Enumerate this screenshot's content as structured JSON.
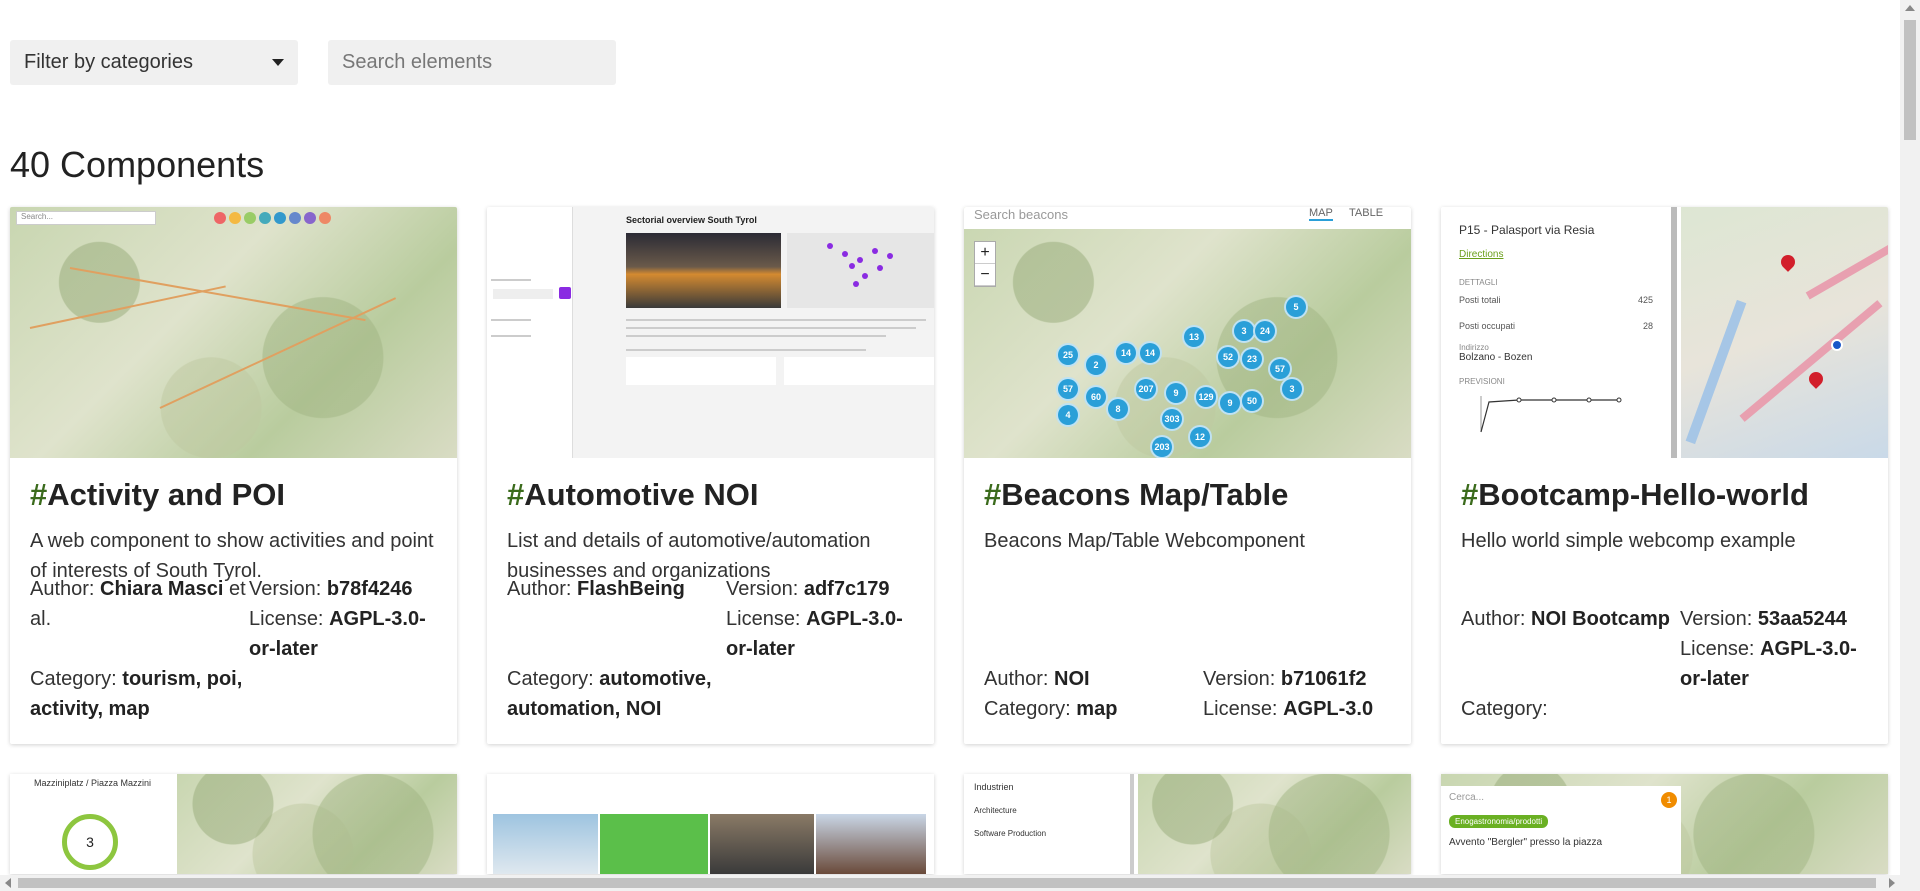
{
  "toolbar": {
    "filter_label": "Filter by categories",
    "search_placeholder": "Search elements"
  },
  "heading": "40 Components",
  "cards": [
    {
      "hash": "#",
      "title": "Activity and POI",
      "description": "A web component to show activities and point of interests of South Tyrol.",
      "author_label": "Author:",
      "author": "Chiara Masci",
      "author_suffix": "et al.",
      "category_label": "Category:",
      "category": "tourism, poi, activity, map",
      "version_label": "Version:",
      "version": "b78f4246",
      "license_label": "License:",
      "license": "AGPL-3.0-or-later",
      "thumb_text": "Search..."
    },
    {
      "hash": "#",
      "title": "Automotive NOI",
      "description": "List and details of automotive/automation businesses and organizations",
      "author_label": "Author:",
      "author": "FlashBeing",
      "category_label": "Category:",
      "category": "automotive, automation, NOI",
      "version_label": "Version:",
      "version": "adf7c179",
      "license_label": "License:",
      "license": "AGPL-3.0-or-later",
      "thumb_text": "Sectorial overview South Tyrol"
    },
    {
      "hash": "#",
      "title": "Beacons Map/Table",
      "description": "Beacons Map/Table Webcomponent",
      "author_label": "Author:",
      "author": "NOI",
      "category_label": "Category:",
      "category": "map",
      "version_label": "Version:",
      "version": "b71061f2",
      "license_label": "License:",
      "license": "AGPL-3.0",
      "thumb_text": "Search beacons",
      "tab_map": "MAP",
      "tab_table": "TABLE",
      "clusters": [
        "5",
        "3",
        "24",
        "13",
        "14",
        "52",
        "23",
        "57",
        "25",
        "2",
        "14",
        "57",
        "60",
        "8",
        "207",
        "9",
        "129",
        "9",
        "50",
        "3",
        "4",
        "303",
        "12",
        "203"
      ]
    },
    {
      "hash": "#",
      "title": "Bootcamp-Hello-world",
      "description": "Hello world simple webcomp example",
      "author_label": "Author:",
      "author": "NOI Bootcamp",
      "category_label": "Category:",
      "category": "",
      "version_label": "Version:",
      "version": "53aa5244",
      "license_label": "License:",
      "license": "AGPL-3.0-or-later",
      "panel_title": "P15 - Palasport via Resia",
      "panel_link": "Directions",
      "panel_details": "DETTAGLI",
      "panel_row1_label": "Posti totali",
      "panel_row1_value": "425",
      "panel_row2_label": "Posti occupati",
      "panel_row2_value": "28",
      "panel_addr_label": "Indirizzo",
      "panel_addr": "Bolzano - Bozen",
      "panel_forecast": "PREVISIONI"
    }
  ],
  "row2": {
    "card1_text": "Mazziniplatz / Piazza Mazzini",
    "card1_number": "3",
    "card3_title": "Industrien",
    "card3_item1": "Architecture",
    "card3_item2": "Software Production",
    "card4_search": "Cerca...",
    "card4_badge": "Enogastronomia/prodotti",
    "card4_text": "Avvento \"Bergler\" presso la piazza",
    "card4_count": "1"
  }
}
